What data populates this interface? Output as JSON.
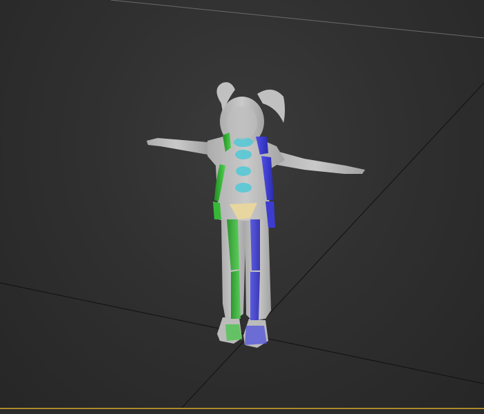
{
  "viewport": {
    "kind": "perspective-3d-viewport",
    "selected_object": "character-biped-rig",
    "colors": {
      "background": "#333333",
      "mesh": "#c9c9c9",
      "biped_left": "#2eae2e",
      "biped_right": "#3a3ad6",
      "spine": "#57c9d6",
      "pelvis": "#e8d6a0",
      "viewport_border": "#b08a2a"
    }
  }
}
